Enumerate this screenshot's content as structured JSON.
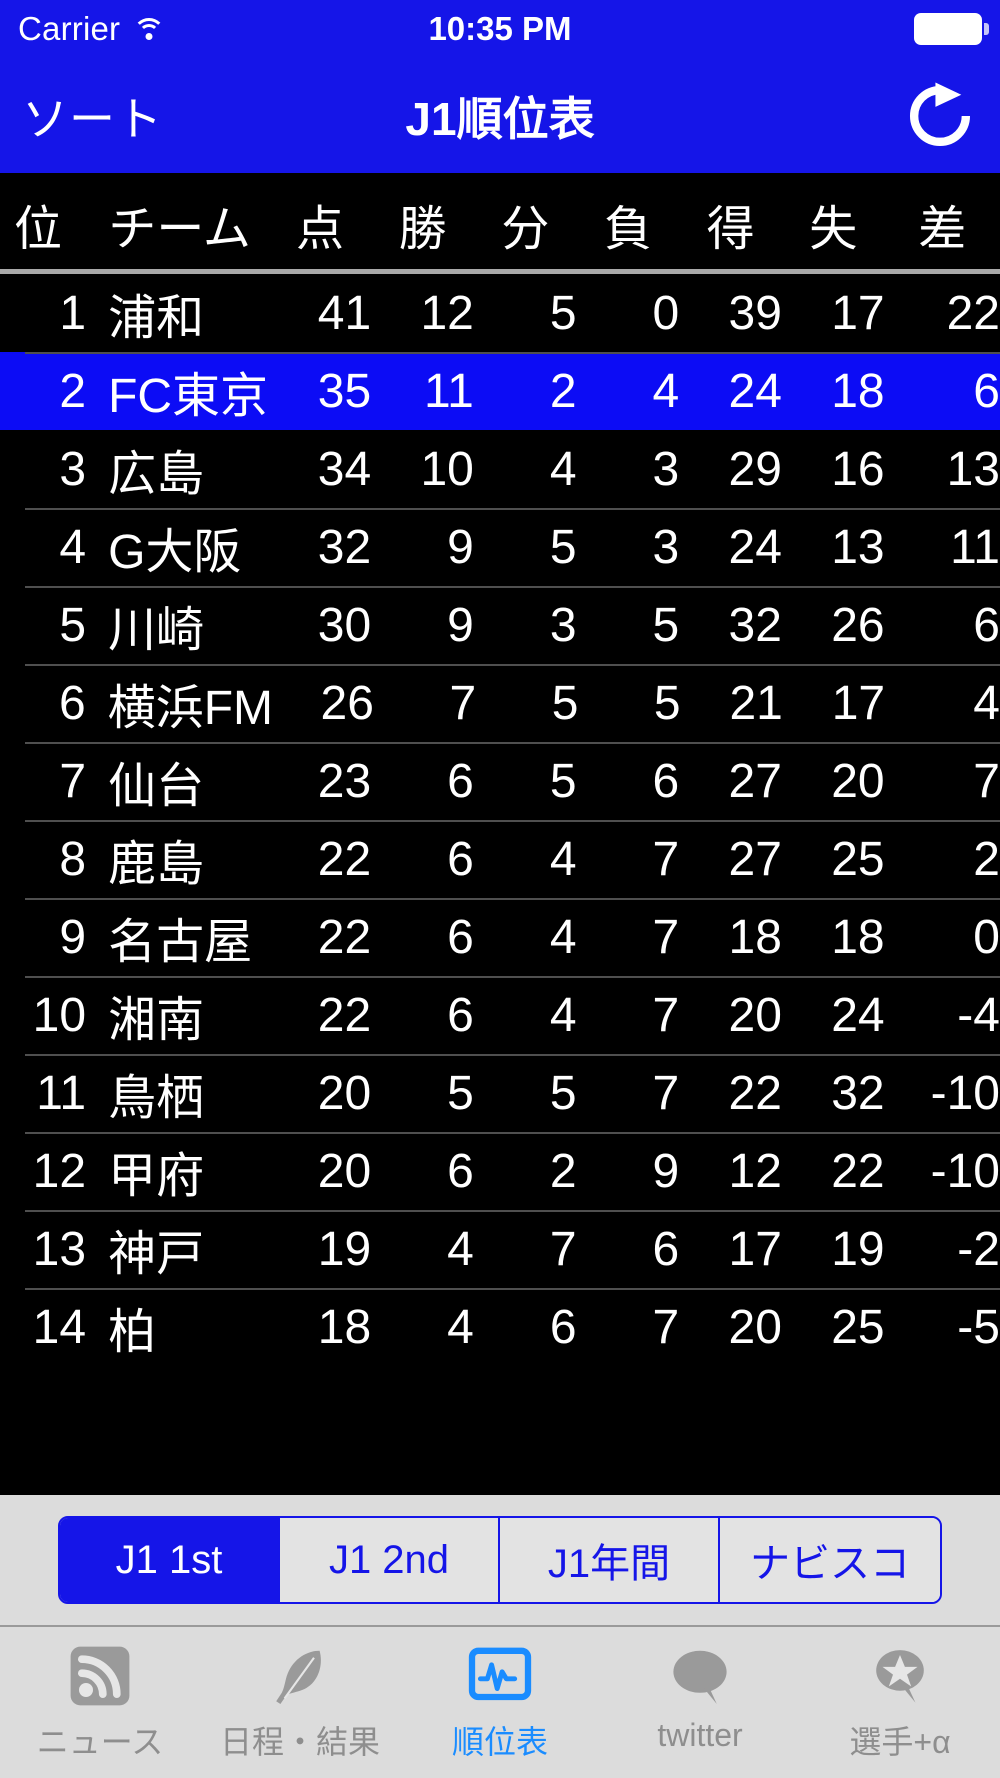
{
  "status_bar": {
    "carrier": "Carrier",
    "wifi_icon": "wifi-icon",
    "time": "10:35 PM",
    "battery_icon": "battery-full-icon"
  },
  "nav_bar": {
    "left_button": "ソート",
    "title": "J1順位表",
    "refresh_icon": "refresh-icon"
  },
  "table": {
    "columns": [
      {
        "key": "rank",
        "label": "位"
      },
      {
        "key": "team",
        "label": "チーム"
      },
      {
        "key": "pts",
        "label": "点"
      },
      {
        "key": "win",
        "label": "勝"
      },
      {
        "key": "draw",
        "label": "分"
      },
      {
        "key": "loss",
        "label": "負"
      },
      {
        "key": "gf",
        "label": "得"
      },
      {
        "key": "ga",
        "label": "失"
      },
      {
        "key": "gd",
        "label": "差"
      }
    ],
    "rows": [
      {
        "rank": "1",
        "team": "浦和",
        "pts": "41",
        "win": "12",
        "draw": "5",
        "loss": "0",
        "gf": "39",
        "ga": "17",
        "gd": "22",
        "selected": false
      },
      {
        "rank": "2",
        "team": "FC東京",
        "pts": "35",
        "win": "11",
        "draw": "2",
        "loss": "4",
        "gf": "24",
        "ga": "18",
        "gd": "6",
        "selected": true
      },
      {
        "rank": "3",
        "team": "広島",
        "pts": "34",
        "win": "10",
        "draw": "4",
        "loss": "3",
        "gf": "29",
        "ga": "16",
        "gd": "13",
        "selected": false
      },
      {
        "rank": "4",
        "team": "G大阪",
        "pts": "32",
        "win": "9",
        "draw": "5",
        "loss": "3",
        "gf": "24",
        "ga": "13",
        "gd": "11",
        "selected": false
      },
      {
        "rank": "5",
        "team": "川崎",
        "pts": "30",
        "win": "9",
        "draw": "3",
        "loss": "5",
        "gf": "32",
        "ga": "26",
        "gd": "6",
        "selected": false
      },
      {
        "rank": "6",
        "team": "横浜FM",
        "pts": "26",
        "win": "7",
        "draw": "5",
        "loss": "5",
        "gf": "21",
        "ga": "17",
        "gd": "4",
        "selected": false
      },
      {
        "rank": "7",
        "team": "仙台",
        "pts": "23",
        "win": "6",
        "draw": "5",
        "loss": "6",
        "gf": "27",
        "ga": "20",
        "gd": "7",
        "selected": false
      },
      {
        "rank": "8",
        "team": "鹿島",
        "pts": "22",
        "win": "6",
        "draw": "4",
        "loss": "7",
        "gf": "27",
        "ga": "25",
        "gd": "2",
        "selected": false
      },
      {
        "rank": "9",
        "team": "名古屋",
        "pts": "22",
        "win": "6",
        "draw": "4",
        "loss": "7",
        "gf": "18",
        "ga": "18",
        "gd": "0",
        "selected": false
      },
      {
        "rank": "10",
        "team": "湘南",
        "pts": "22",
        "win": "6",
        "draw": "4",
        "loss": "7",
        "gf": "20",
        "ga": "24",
        "gd": "-4",
        "selected": false
      },
      {
        "rank": "11",
        "team": "鳥栖",
        "pts": "20",
        "win": "5",
        "draw": "5",
        "loss": "7",
        "gf": "22",
        "ga": "32",
        "gd": "-10",
        "selected": false
      },
      {
        "rank": "12",
        "team": "甲府",
        "pts": "20",
        "win": "6",
        "draw": "2",
        "loss": "9",
        "gf": "12",
        "ga": "22",
        "gd": "-10",
        "selected": false
      },
      {
        "rank": "13",
        "team": "神戸",
        "pts": "19",
        "win": "4",
        "draw": "7",
        "loss": "6",
        "gf": "17",
        "ga": "19",
        "gd": "-2",
        "selected": false
      },
      {
        "rank": "14",
        "team": "柏",
        "pts": "18",
        "win": "4",
        "draw": "6",
        "loss": "7",
        "gf": "20",
        "ga": "25",
        "gd": "-5",
        "selected": false
      }
    ]
  },
  "segmented_control": {
    "options": [
      {
        "label": "J1 1st",
        "active": true
      },
      {
        "label": "J1 2nd",
        "active": false
      },
      {
        "label": "J1年間",
        "active": false
      },
      {
        "label": "ナビスコ",
        "active": false
      }
    ]
  },
  "tab_bar": {
    "items": [
      {
        "label": "ニュース",
        "icon": "rss-icon",
        "active": false
      },
      {
        "label": "日程・結果",
        "icon": "feather-icon",
        "active": false
      },
      {
        "label": "順位表",
        "icon": "chart-monitor-icon",
        "active": true
      },
      {
        "label": "twitter",
        "icon": "speech-bubble-icon",
        "active": false
      },
      {
        "label": "選手+α",
        "icon": "star-bubble-icon",
        "active": false
      }
    ]
  },
  "colors": {
    "accent_blue": "#1515e8",
    "selected_row": "#0c0cf5",
    "active_tab": "#1a8cff",
    "background": "#000000",
    "bottom_bar": "#dcdcdc"
  }
}
